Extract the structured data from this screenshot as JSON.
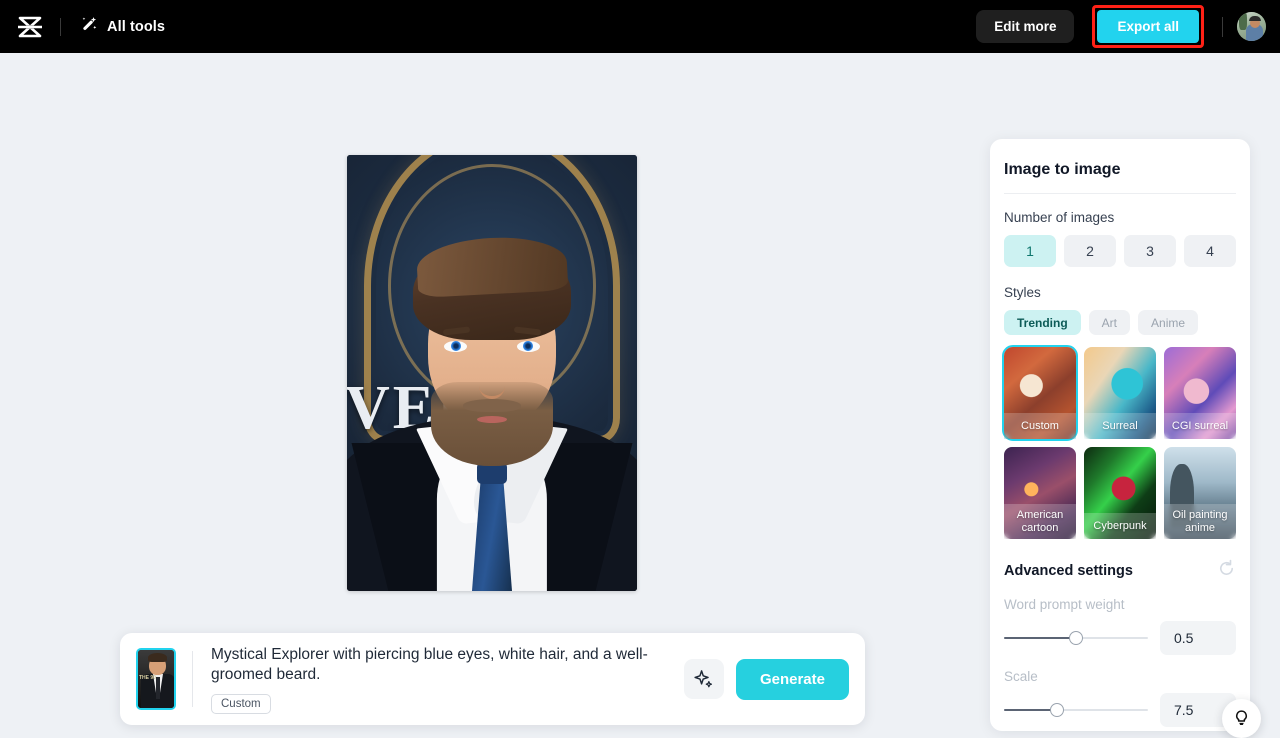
{
  "topbar": {
    "logo_name": "capcut-logo",
    "all_tools_label": "All tools",
    "edit_more_label": "Edit more",
    "export_all_label": "Export all",
    "export_all_highlight_color": "#ff2116",
    "export_all_bg_color": "#22d3ee"
  },
  "preview": {
    "poster_text": "VEL",
    "alt": "generated portrait of bearded man in dark suit with navy tie"
  },
  "prompt_bar": {
    "text": "Mystical Explorer with piercing blue eyes, white hair, and a well-groomed beard.",
    "tag_label": "Custom",
    "thumb_text": "THE 90",
    "generate_label": "Generate",
    "magic_icon": "sparkle-icon"
  },
  "panel": {
    "title": "Image to image",
    "number_of_images": {
      "label": "Number of images",
      "options": [
        "1",
        "2",
        "3",
        "4"
      ],
      "selected": "1"
    },
    "styles": {
      "label": "Styles",
      "tabs": [
        {
          "label": "Trending",
          "active": true
        },
        {
          "label": "Art",
          "active": false
        },
        {
          "label": "Anime",
          "active": false
        }
      ],
      "items": [
        {
          "label": "Custom",
          "selected": true,
          "art": "art-custom"
        },
        {
          "label": "Surreal",
          "selected": false,
          "art": "art-surreal"
        },
        {
          "label": "CGI surreal",
          "selected": false,
          "art": "art-cgi"
        },
        {
          "label": "American cartoon",
          "selected": false,
          "art": "art-american"
        },
        {
          "label": "Cyberpunk",
          "selected": false,
          "art": "art-cyber"
        },
        {
          "label": "Oil painting anime",
          "selected": false,
          "art": "art-oil"
        }
      ],
      "selected_outline_color": "#22d3ee"
    },
    "advanced": {
      "title": "Advanced settings",
      "reset_icon": "reset-icon",
      "sliders": [
        {
          "label": "Word prompt weight",
          "value": "0.5",
          "percent": 50
        },
        {
          "label": "Scale",
          "value": "7.5",
          "percent": 37
        }
      ]
    }
  },
  "fab": {
    "icon": "lightbulb-icon"
  }
}
